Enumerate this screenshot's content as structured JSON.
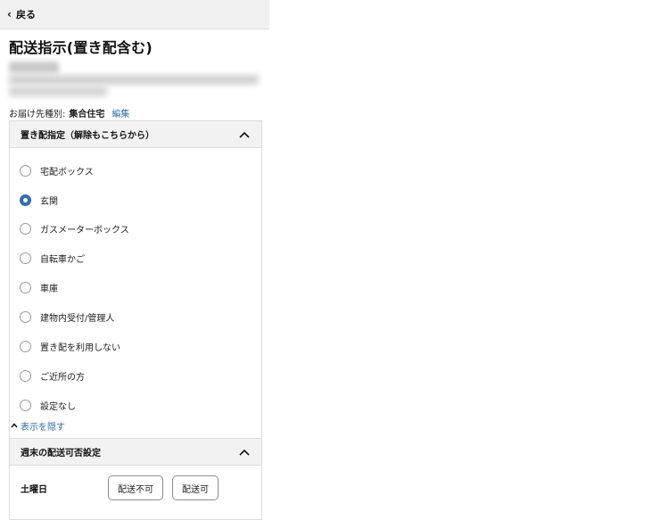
{
  "header": {
    "back_label": "戻る"
  },
  "page": {
    "title": "配送指示(置き配含む)",
    "destination_label": "お届け先種別:",
    "destination_value": "集合住宅",
    "edit_link": "編集"
  },
  "okihai": {
    "heading": "置き配指定（解除もこちらから）",
    "options": [
      {
        "label": "宅配ボックス",
        "selected": false
      },
      {
        "label": "玄関",
        "selected": true
      },
      {
        "label": "ガスメーターボックス",
        "selected": false
      },
      {
        "label": "自転車かご",
        "selected": false
      },
      {
        "label": "車庫",
        "selected": false
      },
      {
        "label": "建物内受付/管理人",
        "selected": false
      },
      {
        "label": "置き配を利用しない",
        "selected": false
      },
      {
        "label": "ご近所の方",
        "selected": false
      },
      {
        "label": "設定なし",
        "selected": false
      }
    ],
    "hide_link": "表示を隠す"
  },
  "weekend": {
    "heading": "週末の配送可否設定",
    "day_label": "土曜日",
    "not_allowed_btn": "配送不可",
    "allowed_btn": "配送可"
  },
  "colors": {
    "accent": "#2f6db4",
    "header_bg": "#f0f0f0"
  }
}
